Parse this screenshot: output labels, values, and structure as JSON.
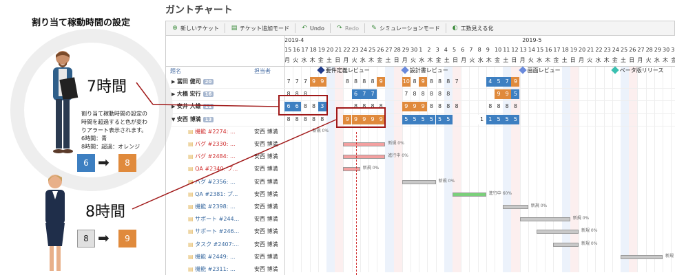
{
  "left": {
    "title": "割り当て稼動時間の設定",
    "hours7": "7時間",
    "hours8": "8時間",
    "desc_lines": [
      "割り当て稼動時間の設定の",
      "時間を超過すると色が変わ",
      "りアラート表示されます。",
      "6時間：青",
      "8時間：超過：オレンジ"
    ],
    "ex1_from": "6",
    "ex1_to": "8",
    "ex2_from": "8",
    "ex2_to": "9"
  },
  "app": {
    "title": "ガントチャート"
  },
  "toolbar": [
    {
      "label": "新しいチケット",
      "icon": "new-ticket-icon",
      "disabled": false
    },
    {
      "label": "チケット追加モード",
      "icon": "add-mode-icon",
      "disabled": false
    },
    {
      "label": "Undo",
      "icon": "undo-icon",
      "disabled": false
    },
    {
      "label": "Redo",
      "icon": "redo-icon",
      "disabled": true
    },
    {
      "label": "シミュレーションモード",
      "icon": "simulation-icon",
      "disabled": false
    },
    {
      "label": "工数見える化",
      "icon": "toggle-icon",
      "disabled": false
    }
  ],
  "months": [
    "2019-4",
    "2019-5"
  ],
  "days": [
    "15",
    "16",
    "17",
    "18",
    "19",
    "20",
    "21",
    "22",
    "23",
    "24",
    "25",
    "26",
    "27",
    "28",
    "29",
    "30",
    "1",
    "2",
    "3",
    "4",
    "5",
    "6",
    "7",
    "8",
    "9",
    "10",
    "11",
    "12",
    "13",
    "14",
    "15",
    "16",
    "17",
    "18",
    "19",
    "20",
    "21",
    "22",
    "23",
    "24",
    "25",
    "26",
    "27",
    "28",
    "29",
    "30",
    "31"
  ],
  "weekdays": [
    "月",
    "火",
    "水",
    "木",
    "金",
    "土",
    "日",
    "月",
    "火",
    "水",
    "木",
    "金",
    "土",
    "日",
    "月",
    "火",
    "水",
    "木",
    "金",
    "土",
    "日",
    "月",
    "火",
    "水",
    "木",
    "金",
    "土",
    "日",
    "月",
    "火",
    "水",
    "木",
    "金",
    "土",
    "日",
    "月",
    "火",
    "水",
    "木",
    "金",
    "土",
    "日",
    "月",
    "火",
    "水",
    "木",
    "金"
  ],
  "columns": {
    "name": "題名",
    "assignee": "担当者"
  },
  "milestones": [
    "要件定義レビュー",
    "設計書レビュー",
    "画面レビュー",
    "ベータ版リリース"
  ],
  "users": [
    {
      "name": "冨田 健司",
      "count": "20",
      "expanded": false
    },
    {
      "name": "大橋 宏行",
      "count": "16",
      "expanded": false
    },
    {
      "name": "安井 大雄",
      "count": "11",
      "expanded": false
    },
    {
      "name": "安西 博満",
      "count": "13",
      "expanded": true
    }
  ],
  "tasks": [
    {
      "title": "機能 #2274: ...",
      "assignee": "安西 博満",
      "red": true,
      "status": "新規 0%"
    },
    {
      "title": "バグ #2330: ...",
      "assignee": "安西 博満",
      "red": true,
      "status": "新規 0%"
    },
    {
      "title": "バグ #2484: ...",
      "assignee": "安西 博満",
      "red": true,
      "status": "進行中 0%"
    },
    {
      "title": "QA #2340: プ...",
      "assignee": "安西 博満",
      "red": true,
      "status": "新規 0%"
    },
    {
      "title": "バグ #2356: ...",
      "assignee": "安西 博満",
      "red": false,
      "status": "新規 0%"
    },
    {
      "title": "QA #2381: プ...",
      "assignee": "安西 博満",
      "red": false,
      "status": "進行中 60%"
    },
    {
      "title": "機能 #2398: ...",
      "assignee": "安西 博満",
      "red": false,
      "status": "新規 0%"
    },
    {
      "title": "サポート #244...",
      "assignee": "安西 博満",
      "red": false,
      "status": "新規 0%"
    },
    {
      "title": "サポート #246...",
      "assignee": "安西 博満",
      "red": false,
      "status": "新規 0%"
    },
    {
      "title": "タスク #2407:...",
      "assignee": "安西 博満",
      "red": false,
      "status": "新規 0%"
    },
    {
      "title": "機能 #2449: ...",
      "assignee": "安西 博満",
      "red": false,
      "status": "新規 0%"
    },
    {
      "title": "機能 #2311: ...",
      "assignee": "安西 博満",
      "red": false,
      "status": ""
    }
  ],
  "colors": {
    "blue": "#3d7fc1",
    "orange": "#e08a3c",
    "red_bar": "#f4a0a0",
    "green_bar": "#7bd07b",
    "gray_bar": "#c8c8c8",
    "highlight": "#a01818"
  }
}
